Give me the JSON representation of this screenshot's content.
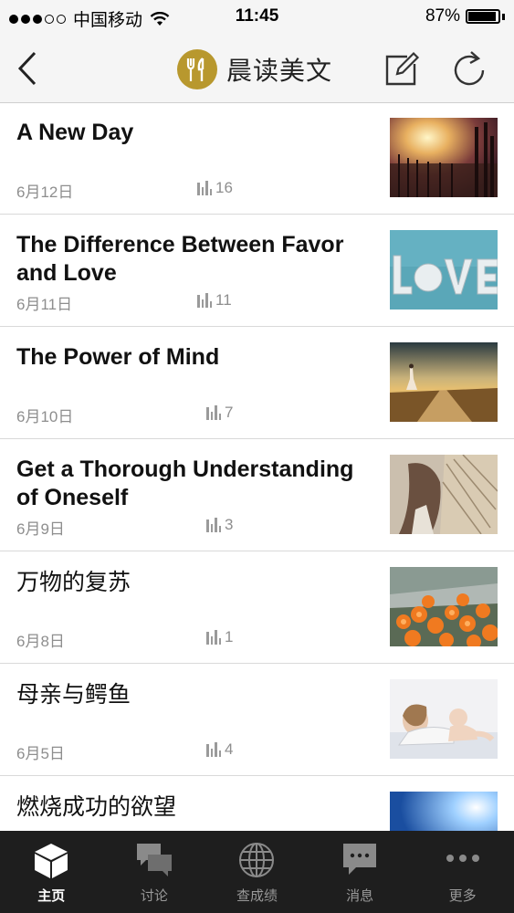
{
  "status_bar": {
    "carrier": "中国移动",
    "time": "11:45",
    "battery": "87%"
  },
  "nav": {
    "title": "晨读美文",
    "back_icon": "chevron-left-icon",
    "logo_icon": "fork-knife-icon",
    "edit_icon": "edit-icon",
    "refresh_icon": "refresh-icon"
  },
  "articles": [
    {
      "title": "A New Day",
      "date": "6月12日",
      "views": "16"
    },
    {
      "title": "The Difference Between Favor and Love",
      "date": "6月11日",
      "views": "11"
    },
    {
      "title": "The Power of Mind",
      "date": "6月10日",
      "views": "7"
    },
    {
      "title": "Get a Thorough Understanding of Oneself",
      "date": "6月9日",
      "views": "3"
    },
    {
      "title": "万物的复苏",
      "date": "6月8日",
      "views": "1"
    },
    {
      "title": "母亲与鳄鱼",
      "date": "6月5日",
      "views": "4"
    },
    {
      "title": "燃烧成功的欲望",
      "date": "",
      "views": ""
    }
  ],
  "tabs": [
    {
      "label": "主页",
      "icon": "cube-icon",
      "active": true
    },
    {
      "label": "讨论",
      "icon": "chat-bubbles-icon",
      "active": false
    },
    {
      "label": "查成绩",
      "icon": "globe-icon",
      "active": false
    },
    {
      "label": "消息",
      "icon": "message-icon",
      "active": false
    },
    {
      "label": "更多",
      "icon": "more-icon",
      "active": false
    }
  ],
  "colors": {
    "logo_gold": "#b8982e",
    "tab_bar_bg": "#1e1e1e",
    "meta_gray": "#8e8e8e"
  }
}
